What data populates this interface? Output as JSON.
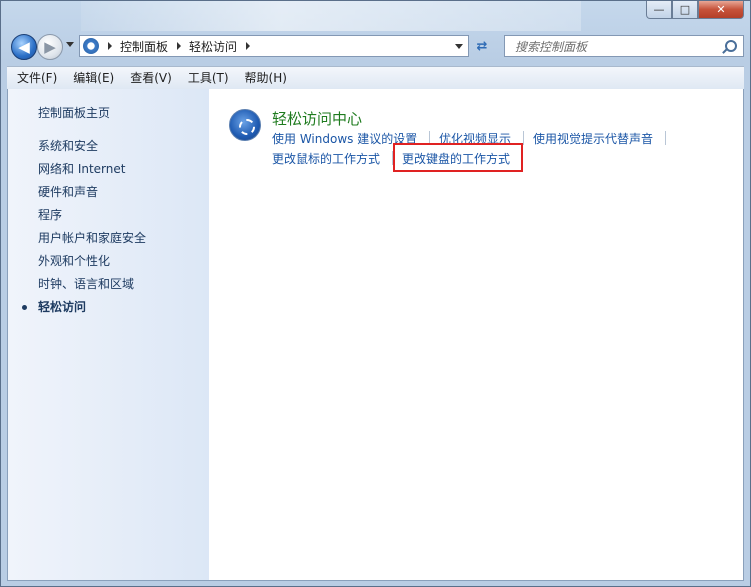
{
  "window": {
    "caption_buttons": {
      "minimize": "—",
      "maximize": "□",
      "close": "✕"
    }
  },
  "nav": {
    "back_icon": "◀",
    "forward_icon": "▶",
    "breadcrumb": [
      "控制面板",
      "轻松访问"
    ],
    "refresh_icon": "⇄",
    "search_placeholder": "搜索控制面板"
  },
  "menu": {
    "items": [
      "文件(F)",
      "编辑(E)",
      "查看(V)",
      "工具(T)",
      "帮助(H)"
    ]
  },
  "sidebar": {
    "items": [
      "控制面板主页",
      "系统和安全",
      "网络和 Internet",
      "硬件和声音",
      "程序",
      "用户帐户和家庭安全",
      "外观和个性化",
      "时钟、语言和区域",
      "轻松访问"
    ],
    "active_index": 8
  },
  "main": {
    "category_title": "轻松访问中心",
    "links_row1": [
      "使用 Windows 建议的设置",
      "优化视频显示",
      "使用视觉提示代替声音"
    ],
    "links_row2": [
      "更改鼠标的工作方式",
      "更改键盘的工作方式"
    ],
    "link_color": "#1b56a6",
    "title_color": "#1e7b1e",
    "highlight_color": "#e02222"
  }
}
